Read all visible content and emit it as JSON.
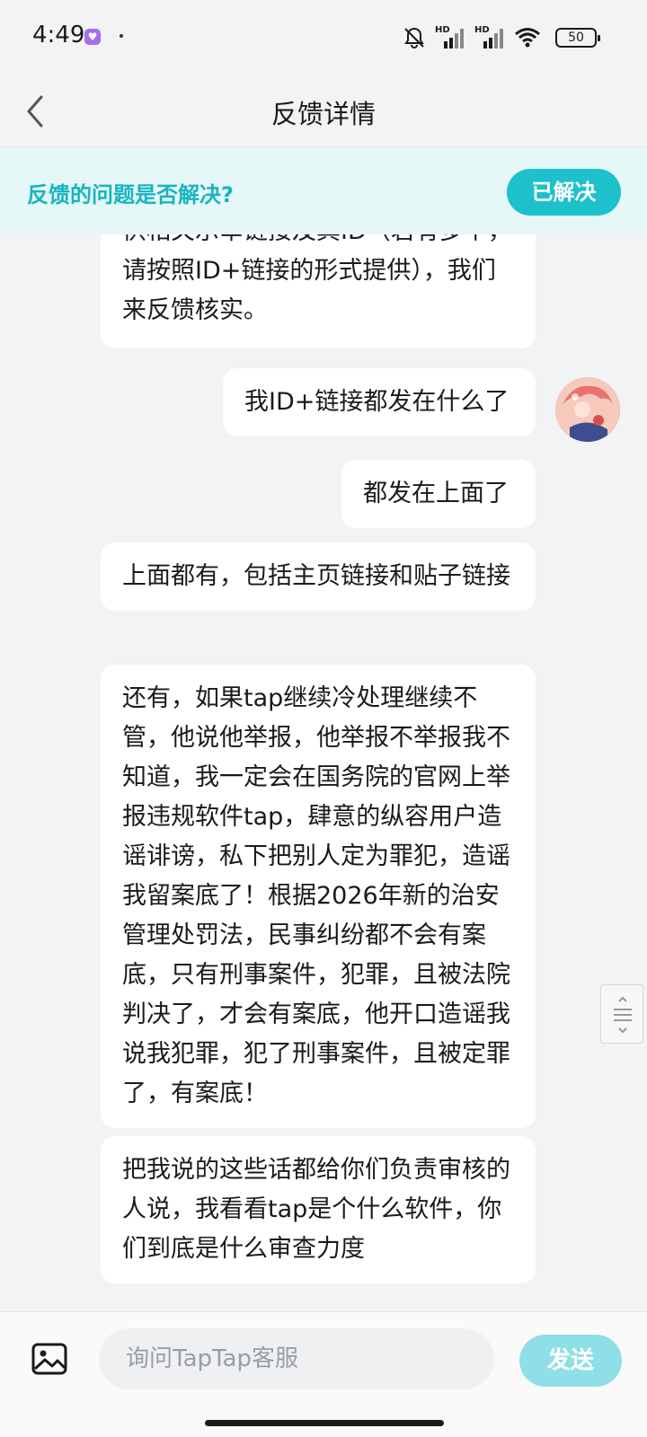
{
  "status_bar": {
    "time": "4:49",
    "battery": "50",
    "network_label": "HD",
    "icons": [
      "mute-icon",
      "signal-icon",
      "signal-icon",
      "wifi-icon",
      "battery-icon"
    ]
  },
  "header": {
    "title": "反馈详情",
    "back_icon": "chevron-left-icon"
  },
  "banner": {
    "question": "反馈的问题是否解决?",
    "resolved_label": "已解决"
  },
  "messages": [
    {
      "side": "left",
      "text": "供相关示举链接及其ID（若有多个，请按照ID+链接的形式提供），我们来反馈核实。"
    },
    {
      "side": "right",
      "text": "我ID+链接都发在什么了"
    },
    {
      "side": "right",
      "text": "都发在上面了"
    },
    {
      "side": "left",
      "text": "上面都有，包括主页链接和贴子链接"
    },
    {
      "side": "left",
      "text": "还有，如果tap继续冷处理继续不管，他说他举报，他举报不举报我不知道，我一定会在国务院的官网上举报违规软件tap，肆意的纵容用户造谣诽谤，私下把别人定为罪犯，造谣我留案底了！根据2026年新的治安管理处罚法，民事纠纷都不会有案底，只有刑事案件，犯罪，且被法院判决了，才会有案底，他开口造谣我说我犯罪，犯了刑事案件，且被定罪了，有案底！"
    },
    {
      "side": "left",
      "text": "把我说的这些话都给你们负责审核的人说，我看看tap是个什么软件，你们到底是什么审查力度"
    }
  ],
  "input": {
    "placeholder": "询问TapTap客服",
    "send_label": "发送",
    "image_icon": "image-icon"
  },
  "colors": {
    "accent": "#1cc1cc",
    "banner_bg": "#e6f7f8",
    "send_disabled": "#8fe0e6",
    "page_bg": "#f2f3f5"
  }
}
